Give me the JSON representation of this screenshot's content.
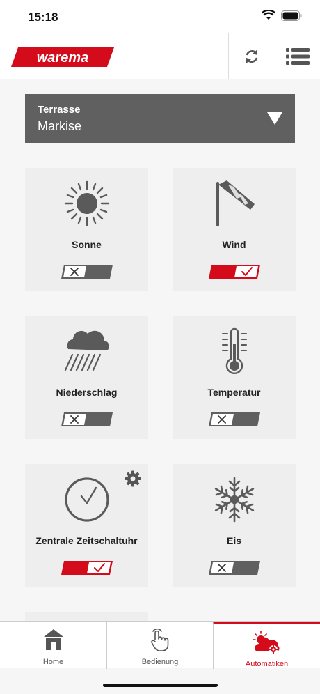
{
  "status": {
    "time": "15:18"
  },
  "header": {
    "brand": "warema"
  },
  "selector": {
    "group": "Terrasse",
    "channel": "Markise"
  },
  "tiles": [
    {
      "label": "Sonne",
      "enabled": false,
      "icon": "sun-icon"
    },
    {
      "label": "Wind",
      "enabled": true,
      "icon": "windsock-icon"
    },
    {
      "label": "Niederschlag",
      "enabled": false,
      "icon": "rain-cloud-icon"
    },
    {
      "label": "Temperatur",
      "enabled": false,
      "icon": "thermometer-icon"
    },
    {
      "label": "Zentrale Zeitschaltuhr",
      "enabled": true,
      "icon": "clock-icon",
      "has_settings": true
    },
    {
      "label": "Eis",
      "enabled": false,
      "icon": "snowflake-icon"
    }
  ],
  "tabs": [
    {
      "label": "Home",
      "icon": "house-icon",
      "active": false
    },
    {
      "label": "Bedienung",
      "icon": "hand-pointer-icon",
      "active": false
    },
    {
      "label": "Automatiken",
      "icon": "sun-cloud-gear-icon",
      "active": true
    }
  ],
  "colors": {
    "accent": "#d30b1a",
    "toggle_off": "#606060",
    "selector_bg": "#606060"
  }
}
